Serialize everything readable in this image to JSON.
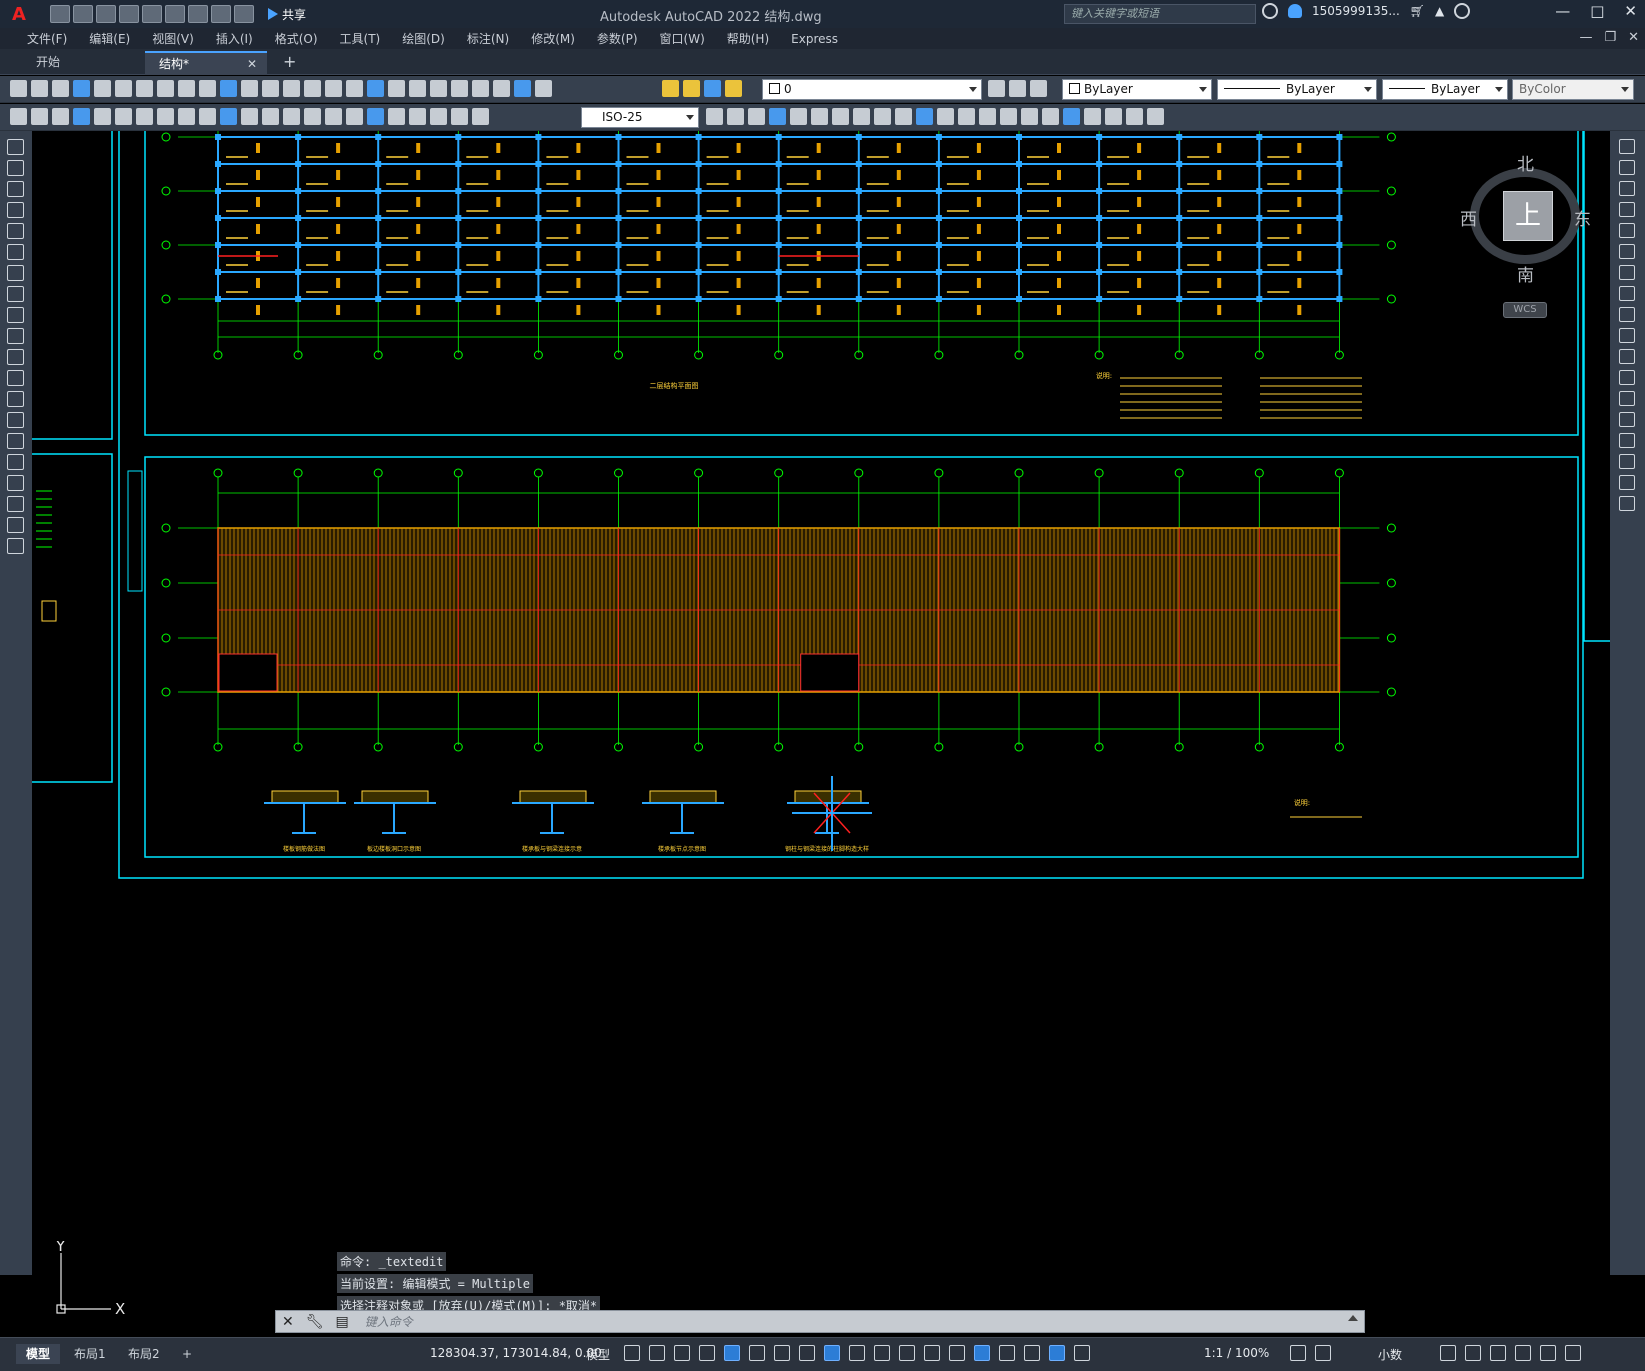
{
  "title_bar": {
    "app_title": "Autodesk AutoCAD 2022    结构.dwg",
    "share_label": "共享",
    "search_placeholder": "键入关键字或短语",
    "user_name": "1505999135..."
  },
  "menu": {
    "items": [
      "文件(F)",
      "编辑(E)",
      "视图(V)",
      "插入(I)",
      "格式(O)",
      "工具(T)",
      "绘图(D)",
      "标注(N)",
      "修改(M)",
      "参数(P)",
      "窗口(W)",
      "帮助(H)",
      "Express"
    ]
  },
  "doc_tabs": [
    {
      "label": "开始",
      "active": false
    },
    {
      "label": "结构*",
      "active": true
    }
  ],
  "toolbar": {
    "layer_value": "0",
    "color_value": "ByLayer",
    "linetype_value": "ByLayer",
    "lineweight_value": "ByLayer",
    "plotstyle_value": "ByColor",
    "dimstyle_value": "ISO-25"
  },
  "viewcube": {
    "north": "北",
    "south": "南",
    "west": "西",
    "east": "东",
    "face": "上",
    "wcs": "WCS"
  },
  "ucs": {
    "x_label": "X",
    "y_label": "Y"
  },
  "command": {
    "history": [
      "命令: _textedit",
      "当前设置: 编辑模式 = Multiple",
      "选择注释对象或 [放弃(U)/模式(M)]: *取消*"
    ],
    "placeholder": "键入命令"
  },
  "status": {
    "layout_tabs": [
      "模型",
      "布局1",
      "布局2"
    ],
    "coordinates": "128304.37, 173014.84, 0.00",
    "model_label": "模型",
    "scale": "1:1 / 100%",
    "units": "小数"
  },
  "drawing": {
    "upper_plan_title": "二层结构平面图",
    "upper_notes_label": "说明:",
    "lower_notes_label": "说明:",
    "grid_numbers": [
      "1",
      "2",
      "3",
      "4",
      "5",
      "6",
      "7",
      "8",
      "9",
      "10",
      "11",
      "12",
      "13",
      "14",
      "15"
    ],
    "grid_letters": [
      "D",
      "C",
      "B",
      "A"
    ],
    "detail_titles": [
      "楼板钢筋做法图",
      "板边楼板洞口示意图",
      "楼承板与钢梁连接示意",
      "楼承板节点示意图",
      "钢柱与钢梁连接的柱脚构造大样"
    ]
  },
  "colors": {
    "canvas": "#000000",
    "frame": "#00e5ff",
    "grid": "#00ff00",
    "beam": "#2aa8ff",
    "deck": "#e6a000",
    "annotation": "#ffd23a",
    "axis_red": "#ff2020",
    "accent": "#4aa3ff"
  }
}
